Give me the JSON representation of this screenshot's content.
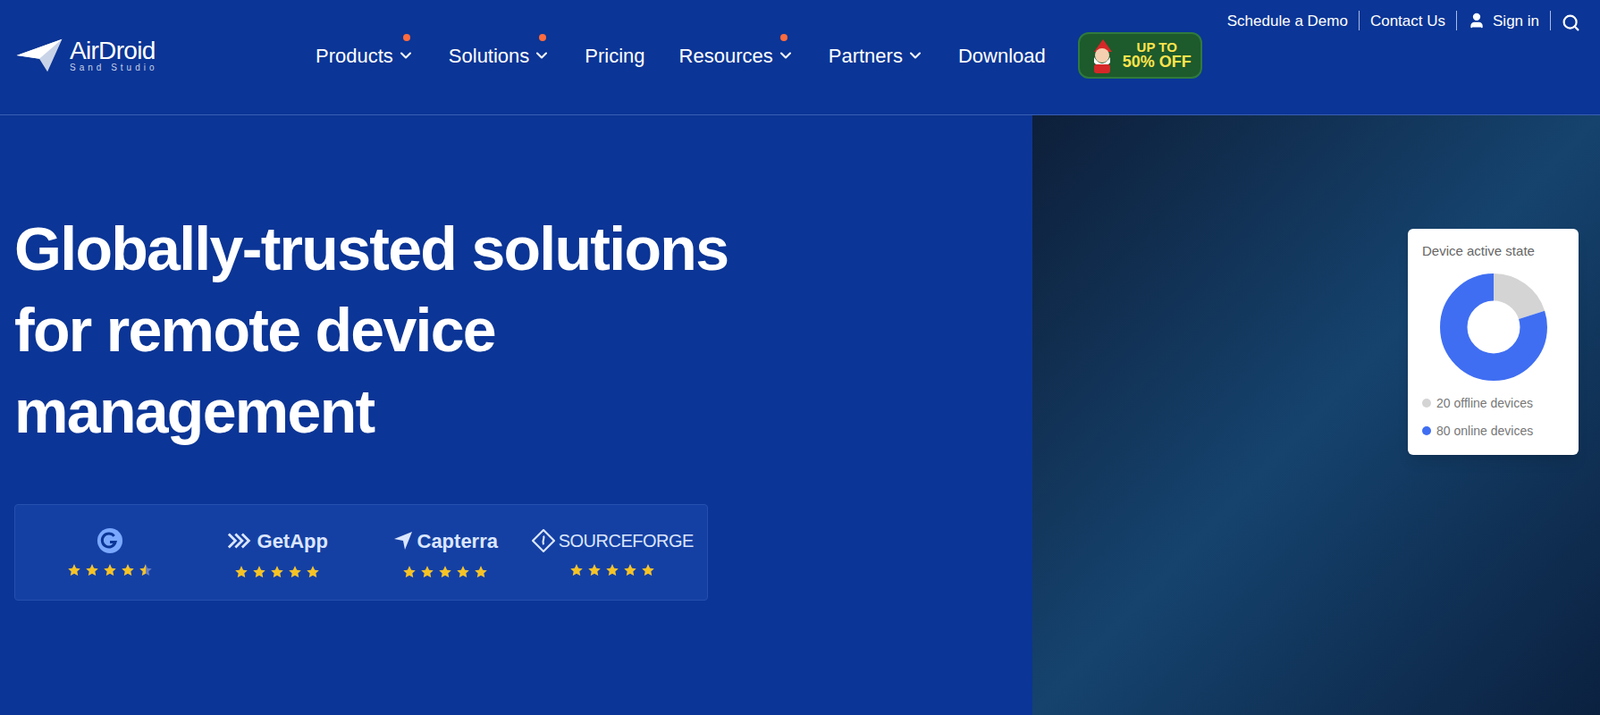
{
  "header": {
    "logo": {
      "name": "AirDroid",
      "tagline": "Sand Studio"
    },
    "nav": [
      {
        "label": "Products",
        "has_dot": true,
        "has_dropdown": true
      },
      {
        "label": "Solutions",
        "has_dot": true,
        "has_dropdown": true
      },
      {
        "label": "Pricing",
        "has_dot": false,
        "has_dropdown": false
      },
      {
        "label": "Resources",
        "has_dot": true,
        "has_dropdown": true
      },
      {
        "label": "Partners",
        "has_dot": false,
        "has_dropdown": true
      },
      {
        "label": "Download",
        "has_dot": false,
        "has_dropdown": false
      }
    ],
    "promo": [
      "UP TO",
      "50% OFF"
    ],
    "top_links": [
      {
        "label": "Schedule a Demo",
        "kind": "text"
      },
      {
        "label": "Contact Us",
        "kind": "text"
      },
      {
        "label": "Sign in",
        "kind": "user"
      }
    ]
  },
  "hero": {
    "headline": [
      "Globally-trusted solutions",
      "for remote device",
      "management"
    ],
    "ratings": [
      {
        "site": "",
        "kind": "g2",
        "stars": 4.5
      },
      {
        "site": "GetApp",
        "kind": "getapp",
        "stars": 5
      },
      {
        "site": "Capterra",
        "kind": "capterra",
        "stars": 5
      },
      {
        "site": "SOURCEFORGE",
        "kind": "sourceforge",
        "stars": 5
      }
    ]
  },
  "device_card": {
    "title": "Device active state",
    "series": [
      {
        "label": "20 offline devices",
        "value": 20,
        "color": "#d4d4d4"
      },
      {
        "label": "80 online devices",
        "value": 80,
        "color": "#3f6ef2"
      }
    ]
  }
}
